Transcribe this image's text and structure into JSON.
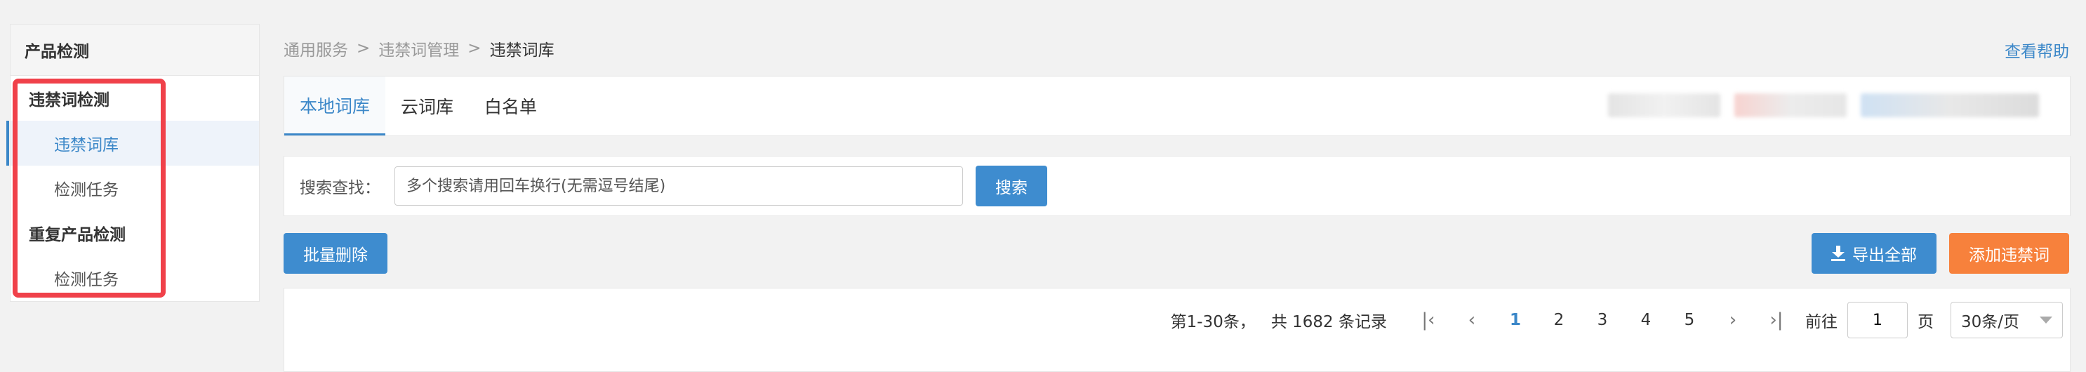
{
  "sidebar": {
    "title": "产品检测",
    "groups": [
      {
        "label": "违禁词检测",
        "items": [
          {
            "label": "违禁词库"
          },
          {
            "label": "检测任务"
          }
        ]
      },
      {
        "label": "重复产品检测",
        "items": [
          {
            "label": "检测任务"
          }
        ]
      }
    ]
  },
  "breadcrumb": [
    "通用服务",
    "违禁词管理",
    "违禁词库"
  ],
  "breadcrumb_separator": ">",
  "help_link": "查看帮助",
  "tabs": [
    {
      "label": "本地词库",
      "active": true
    },
    {
      "label": "云词库"
    },
    {
      "label": "白名单"
    }
  ],
  "search": {
    "label": "搜索查找：",
    "placeholder": "多个搜索请用回车换行(无需逗号结尾)",
    "button": "搜索"
  },
  "actions": {
    "bulk_delete": "批量删除",
    "export_all": "导出全部",
    "add_word": "添加违禁词"
  },
  "pagination": {
    "summary": "第1-30条，",
    "total": "共 1682 条记录",
    "pages": [
      "1",
      "2",
      "3",
      "4",
      "5"
    ],
    "current_page": "1",
    "goto_label": "前往",
    "goto_value": "1",
    "page_unit": "页",
    "page_size": "30条/页"
  },
  "colors": {
    "primary": "#3e8ccf",
    "orange": "#f7813c",
    "highlight_border": "#f0414a"
  }
}
